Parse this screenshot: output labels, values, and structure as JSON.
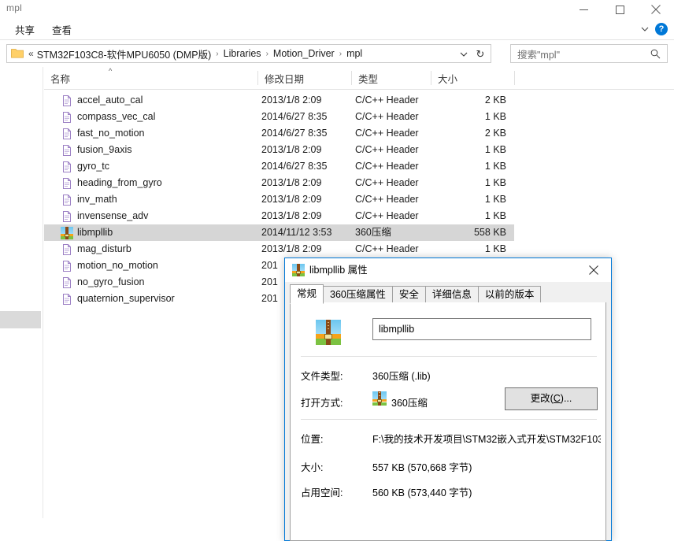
{
  "window": {
    "title": "mpl",
    "minimize_label": "最小化",
    "maximize_label": "最大化",
    "close_label": "关闭"
  },
  "ribbon": {
    "tabs": [
      {
        "label": "共享",
        "name": "tab-share"
      },
      {
        "label": "查看",
        "name": "tab-view"
      }
    ],
    "expand_label": "∨",
    "help_label": "?"
  },
  "address": {
    "prefix": "«",
    "crumbs": [
      "STM32F103C8-软件MPU6050 (DMP版)",
      "Libraries",
      "Motion_Driver",
      "mpl"
    ],
    "separator": "›",
    "dropdown_label": "∨",
    "refresh_label": "↻"
  },
  "search": {
    "placeholder": "搜索\"mpl\""
  },
  "columns": [
    {
      "label": "名称",
      "key": "name"
    },
    {
      "label": "修改日期",
      "key": "date"
    },
    {
      "label": "类型",
      "key": "type"
    },
    {
      "label": "大小",
      "key": "size"
    }
  ],
  "sort_caret": "^",
  "files": [
    {
      "name": "accel_auto_cal",
      "date": "2013/1/8 2:09",
      "type": "C/C++ Header",
      "size": "2 KB",
      "icon": "header-file-icon",
      "selected": false
    },
    {
      "name": "compass_vec_cal",
      "date": "2014/6/27 8:35",
      "type": "C/C++ Header",
      "size": "1 KB",
      "icon": "header-file-icon",
      "selected": false
    },
    {
      "name": "fast_no_motion",
      "date": "2014/6/27 8:35",
      "type": "C/C++ Header",
      "size": "2 KB",
      "icon": "header-file-icon",
      "selected": false
    },
    {
      "name": "fusion_9axis",
      "date": "2013/1/8 2:09",
      "type": "C/C++ Header",
      "size": "1 KB",
      "icon": "header-file-icon",
      "selected": false
    },
    {
      "name": "gyro_tc",
      "date": "2014/6/27 8:35",
      "type": "C/C++ Header",
      "size": "1 KB",
      "icon": "header-file-icon",
      "selected": false
    },
    {
      "name": "heading_from_gyro",
      "date": "2013/1/8 2:09",
      "type": "C/C++ Header",
      "size": "1 KB",
      "icon": "header-file-icon",
      "selected": false
    },
    {
      "name": "inv_math",
      "date": "2013/1/8 2:09",
      "type": "C/C++ Header",
      "size": "1 KB",
      "icon": "header-file-icon",
      "selected": false
    },
    {
      "name": "invensense_adv",
      "date": "2013/1/8 2:09",
      "type": "C/C++ Header",
      "size": "1 KB",
      "icon": "header-file-icon",
      "selected": false
    },
    {
      "name": "libmpllib",
      "date": "2014/11/12 3:53",
      "type": "360压缩",
      "size": "558 KB",
      "icon": "zip-360-icon",
      "selected": true
    },
    {
      "name": "mag_disturb",
      "date": "2013/1/8 2:09",
      "type": "C/C++ Header",
      "size": "1 KB",
      "icon": "header-file-icon",
      "selected": false
    },
    {
      "name": "motion_no_motion",
      "date": "201",
      "type": "",
      "size": "",
      "icon": "header-file-icon",
      "selected": false
    },
    {
      "name": "no_gyro_fusion",
      "date": "201",
      "type": "",
      "size": "",
      "icon": "header-file-icon",
      "selected": false
    },
    {
      "name": "quaternion_supervisor",
      "date": "201",
      "type": "",
      "size": "",
      "icon": "header-file-icon",
      "selected": false
    }
  ],
  "dialog": {
    "title": "libmpllib 属性",
    "close_label": "✕",
    "tabs": [
      {
        "label": "常规",
        "active": true
      },
      {
        "label": "360压缩属性",
        "active": false
      },
      {
        "label": "安全",
        "active": false
      },
      {
        "label": "详细信息",
        "active": false
      },
      {
        "label": "以前的版本",
        "active": false
      }
    ],
    "filename_value": "libmpllib",
    "rows": [
      {
        "label": "文件类型:",
        "value": "360压缩 (.lib)"
      },
      {
        "label": "打开方式:",
        "value": "360压缩"
      },
      {
        "label": "位置:",
        "value": "F:\\我的技术开发项目\\STM32嵌入式开发\\STM32F103"
      },
      {
        "label": "大小:",
        "value": "557 KB (570,668 字节)"
      },
      {
        "label": "占用空间:",
        "value": "560 KB (573,440 字节)"
      }
    ],
    "change_button": {
      "text": "更改(",
      "accel": "C",
      "suffix": ")..."
    }
  },
  "colors": {
    "accent": "#0078d7",
    "selection": "#d6d6d6",
    "help_badge": "#0078d7",
    "button_face": "#e1e1e1"
  }
}
